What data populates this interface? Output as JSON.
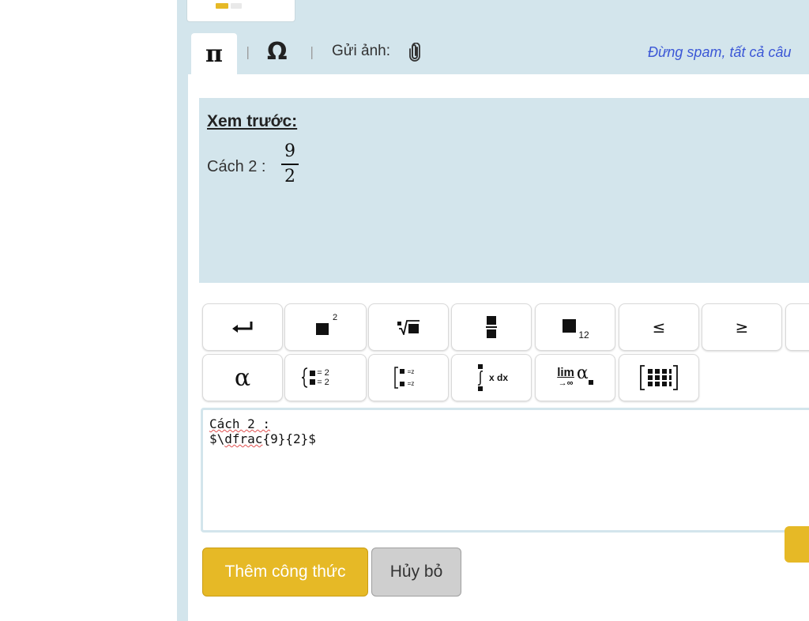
{
  "toolbar": {
    "send_image_label": "Gửi ảnh:",
    "warning_text": "Đừng spam, tất cả câu",
    "pi_symbol": "π",
    "omega_symbol": "Ω",
    "separator": "|"
  },
  "preview": {
    "title": "Xem trước:",
    "text_prefix": "Cách 2 :",
    "fraction": {
      "numerator": "9",
      "denominator": "2"
    }
  },
  "keyboard": {
    "row1": [
      {
        "name": "enter-key",
        "icon": "enter-icon"
      },
      {
        "name": "superscript-key",
        "icon": "superscript-icon",
        "label": "2"
      },
      {
        "name": "nth-root-key",
        "icon": "nth-root-icon"
      },
      {
        "name": "fraction-key",
        "icon": "fraction-icon"
      },
      {
        "name": "subscript-key",
        "icon": "subscript-icon",
        "label": "12"
      },
      {
        "name": "less-equal-key",
        "label": "≤"
      },
      {
        "name": "greater-equal-key",
        "label": "≥"
      }
    ],
    "row2": [
      {
        "name": "alpha-key",
        "label": "α"
      },
      {
        "name": "equation-system-key",
        "icon": "equation-system-icon",
        "label": "= 2"
      },
      {
        "name": "bracket-system-key",
        "icon": "bracket-system-icon",
        "label": "=z"
      },
      {
        "name": "integral-key",
        "icon": "integral-icon",
        "label": "x dx"
      },
      {
        "name": "limit-key",
        "label_top": "lim",
        "label_sub": "→∞",
        "label_symbol": "α"
      },
      {
        "name": "matrix-key",
        "icon": "matrix-icon"
      }
    ]
  },
  "editor": {
    "line1": "Cách 2 :",
    "line2_prefix": "$\\",
    "line2_cmd": "dfrac",
    "line2_suffix": "{9}{2}$"
  },
  "buttons": {
    "add_formula": "Thêm công thức",
    "cancel": "Hủy bỏ"
  },
  "colors": {
    "panel_bg": "#d3e5ec",
    "accent_yellow": "#e6b926",
    "warning_blue": "#3b57d6"
  }
}
